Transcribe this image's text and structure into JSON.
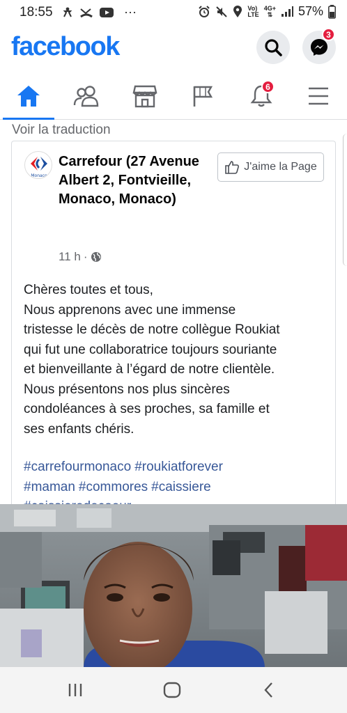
{
  "status_bar": {
    "time": "18:55",
    "ellipsis": "···",
    "network_top": "Vo)",
    "network_bottom": "LTE",
    "signal_type": "4G+",
    "battery": "57%"
  },
  "header": {
    "logo": "facebook",
    "messenger_badge": "3"
  },
  "nav": {
    "tabs": [
      "home",
      "friends",
      "marketplace",
      "pages",
      "notifications",
      "menu"
    ],
    "active": "home",
    "notifications_badge": "6"
  },
  "feed": {
    "translate_link": "Voir la traduction",
    "post": {
      "page_name": "Carrefour (27 Avenue Albert 2, Fontvieille, Monaco, Monaco)",
      "like_page_label": "J'aime la Page",
      "avatar_sub": "Monaco",
      "time_ago": "11 h",
      "meta_sep": "·",
      "text_lines": [
        "Chères toutes et tous,",
        "Nous apprenons avec une immense",
        "tristesse le décès de notre collègue Roukiat",
        "qui fut une collaboratrice toujours souriante",
        "et bienveillante à l’égard de notre clientèle.",
        "Nous présentons nos plus sincères",
        "condoléances à ses proches, sa famille et",
        "ses enfants chéris."
      ],
      "hashtags": [
        "#carrefourmonaco",
        "#roukiatforever",
        "#maman",
        "#commores",
        "#caissiere",
        "#caissieredecoeur"
      ]
    }
  },
  "colors": {
    "brand": "#1877f2",
    "badge": "#e41e3f",
    "hashtag": "#385898",
    "meta": "#65676b"
  },
  "icons": [
    "home-icon",
    "friends-icon",
    "marketplace-icon",
    "flag-icon",
    "bell-icon",
    "menu-icon",
    "search-icon",
    "messenger-icon",
    "globe-icon",
    "thumbs-up-icon"
  ]
}
